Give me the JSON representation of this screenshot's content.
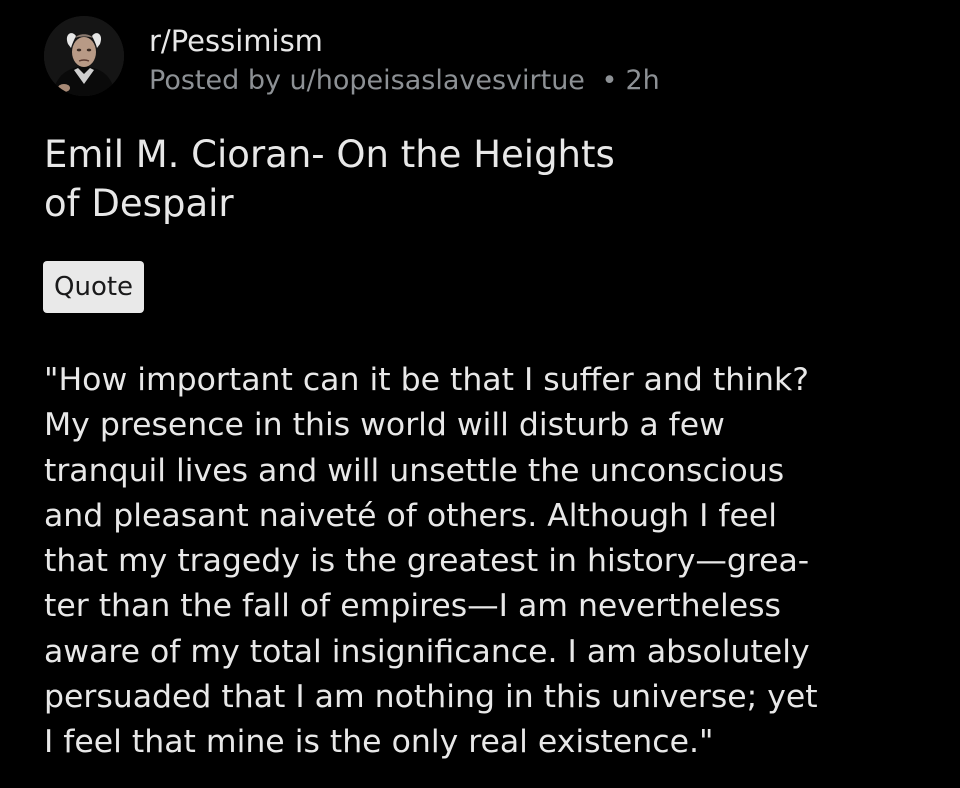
{
  "post": {
    "subreddit": "r/Pessimism",
    "posted_by_prefix": "Posted by",
    "author": "u/hopeisaslavesvirtue",
    "separator": "•",
    "age": "2h",
    "title_lines": [
      "Emil M. Cioran- On the Heights",
      "of Despair"
    ],
    "flair": "Quote",
    "body_lines": [
      "\"How important can it be that I suffer and think?",
      "My presence in this world will disturb a few",
      "tranquil lives and will unsettle the unconscious",
      "and pleasant naiveté of others. Although I feel",
      "that my tragedy is the greatest in history—grea-",
      "ter than the fall of empires—I am nevertheless",
      "aware of my total insignificance. I am absolutely",
      "persuaded that I am nothing in this universe; yet",
      "I feel that mine is the only real existence.\""
    ]
  },
  "colors": {
    "background": "#000000",
    "primary_text": "#e8e8e8",
    "secondary_text": "#8d9195",
    "flair_background": "#e9e9e9",
    "flair_text": "#1a1a1b"
  },
  "icons": {
    "avatar": "subreddit-avatar-portrait"
  }
}
